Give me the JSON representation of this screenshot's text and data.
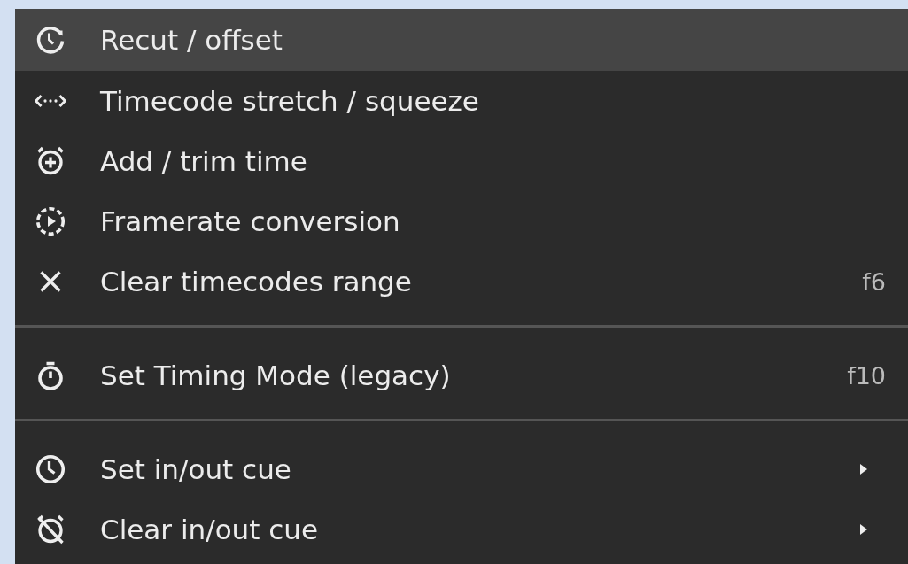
{
  "menu": {
    "items": [
      {
        "kind": "item",
        "label": "Recut / offset",
        "selected": true
      },
      {
        "kind": "item",
        "label": "Timecode stretch / squeeze",
        "selected": false
      },
      {
        "kind": "item",
        "label": "Add / trim time",
        "selected": false
      },
      {
        "kind": "item",
        "label": "Framerate conversion",
        "selected": false
      },
      {
        "kind": "item",
        "label": "Clear timecodes range",
        "shortcut": "f6",
        "selected": false
      },
      {
        "kind": "separator"
      },
      {
        "kind": "item",
        "label": "Set Timing Mode (legacy)",
        "shortcut": "f10",
        "selected": false
      },
      {
        "kind": "separator"
      },
      {
        "kind": "item",
        "label": "Set in/out cue",
        "has_submenu": true,
        "selected": false
      },
      {
        "kind": "item",
        "label": "Clear in/out cue",
        "has_submenu": true,
        "selected": false
      }
    ]
  }
}
